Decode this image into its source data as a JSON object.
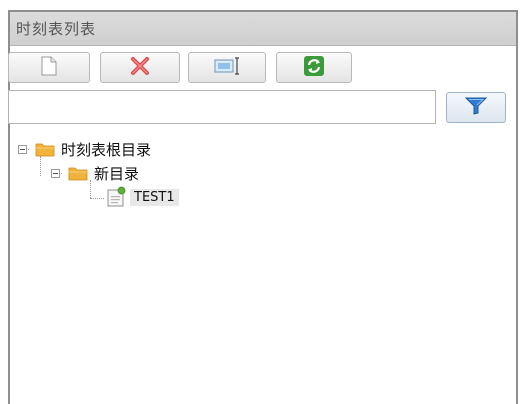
{
  "window": {
    "title": "时刻表列表"
  },
  "toolbar": {
    "buttons": [
      {
        "name": "new-button",
        "icon": "new-document-icon"
      },
      {
        "name": "delete-button",
        "icon": "red-x-icon"
      },
      {
        "name": "rename-button",
        "icon": "rename-field-icon"
      },
      {
        "name": "refresh-button",
        "icon": "green-refresh-icon"
      }
    ]
  },
  "search": {
    "value": "",
    "placeholder": "",
    "filter_icon": "funnel-filter-icon"
  },
  "tree": {
    "root": {
      "label": "时刻表根目录",
      "expanded": true
    },
    "child": {
      "label": "新目录",
      "expanded": true
    },
    "leaf": {
      "label": "TEST1"
    }
  },
  "colors": {
    "folder": "#f2b33d",
    "delete_red": "#d9534f",
    "refresh_green": "#3fa33f",
    "filter_blue": "#2f7bd1"
  }
}
